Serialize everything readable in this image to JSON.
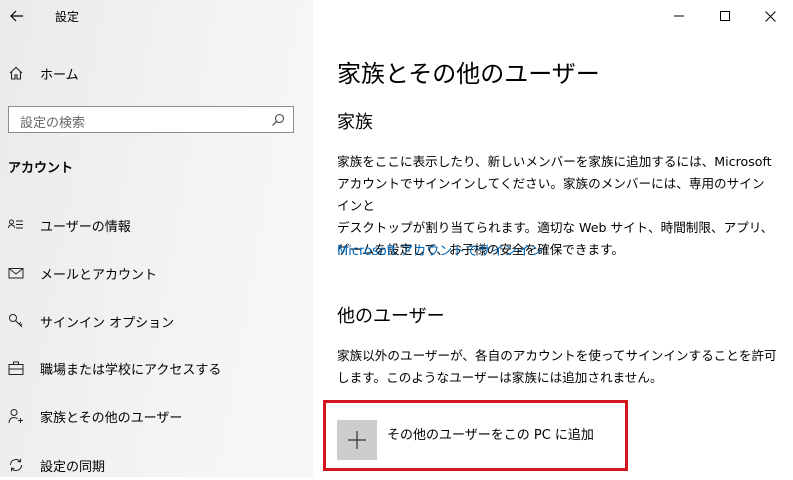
{
  "window": {
    "app_title": "設定",
    "minimize_icon": "minimize-icon",
    "maximize_icon": "maximize-icon",
    "close_icon": "close-icon"
  },
  "sidebar": {
    "home_label": "ホーム",
    "search_placeholder": "設定の検索",
    "section_title": "アカウント",
    "items": [
      {
        "label": "ユーザーの情報",
        "icon": "user-info-icon"
      },
      {
        "label": "メールとアカウント",
        "icon": "mail-icon"
      },
      {
        "label": "サインイン オプション",
        "icon": "key-icon"
      },
      {
        "label": "職場または学校にアクセスする",
        "icon": "briefcase-icon"
      },
      {
        "label": "家族とその他のユーザー",
        "icon": "person-add-icon"
      },
      {
        "label": "設定の同期",
        "icon": "sync-icon"
      }
    ]
  },
  "main": {
    "page_title": "家族とその他のユーザー",
    "family": {
      "heading": "家族",
      "description_lines": [
        "家族をここに表示したり、新しいメンバーを家族に追加するには、Microsoft",
        "アカウントでサインインしてください。家族のメンバーには、専用のサインインと",
        "デスクトップが割り当てられます。適切な Web サイト、時間制限、アプリ、",
        "ゲームを設定して、お子様の安全を確保できます。"
      ],
      "signin_link": "Microsoft アカウントでサインイン"
    },
    "other_users": {
      "heading": "他のユーザー",
      "description_lines": [
        "家族以外のユーザーが、各自のアカウントを使ってサインインすることを許可",
        "します。このようなユーザーは家族には追加されません。"
      ],
      "add_button_label": "その他のユーザーをこの PC に追加"
    }
  },
  "colors": {
    "link": "#0067b8",
    "highlight": "#d3141c"
  }
}
